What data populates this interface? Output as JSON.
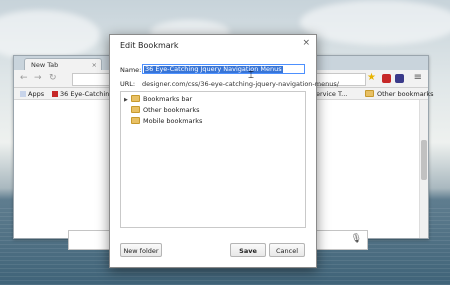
{
  "browser": {
    "tab_title": "New Tab",
    "tab_close": "×",
    "bookmarks_bar": [
      {
        "label": "Apps",
        "icon": "apps-grid-icon"
      },
      {
        "label": "36 Eye-Catching J",
        "icon": "page-favicon"
      },
      {
        "label": "ervice T...",
        "icon": "none"
      },
      {
        "label": "Other bookmarks",
        "icon": "folder-icon"
      }
    ]
  },
  "dialog": {
    "title": "Edit Bookmark",
    "close": "×",
    "name_label": "Name:",
    "name_value": "36 Eye-Catching Jquery Navigation Menus",
    "url_label": "URL:",
    "url_value": "designer.com/css/36-eye-catching-jquery-navigation-menus/",
    "folders": [
      {
        "label": "Bookmarks bar",
        "expandable": true
      },
      {
        "label": "Other bookmarks",
        "expandable": false
      },
      {
        "label": "Mobile bookmarks",
        "expandable": false
      }
    ],
    "new_folder_label": "New folder",
    "save_label": "Save",
    "cancel_label": "Cancel"
  },
  "colors": {
    "accent": "#3875d7",
    "folder": "#e8c064"
  }
}
